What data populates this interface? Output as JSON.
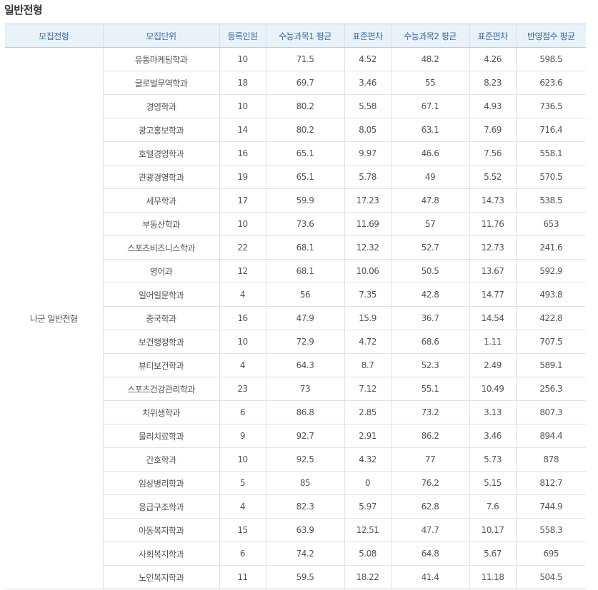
{
  "section_title": "일반전형",
  "headers": [
    "모집전형",
    "모집단위",
    "등록인원",
    "수능과목1 평균",
    "표준편차",
    "수능과목2 평균",
    "표준편차",
    "반영점수 평균"
  ],
  "admission_type": "나군 일반전형",
  "rows": [
    [
      "유통마케팅학과",
      "10",
      "71.5",
      "4.52",
      "48.2",
      "4.26",
      "598.5"
    ],
    [
      "글로벌무역학과",
      "18",
      "69.7",
      "3.46",
      "55",
      "8.23",
      "623.6"
    ],
    [
      "경영학과",
      "10",
      "80.2",
      "5.58",
      "67.1",
      "4.93",
      "736.5"
    ],
    [
      "광고홍보학과",
      "14",
      "80.2",
      "8.05",
      "63.1",
      "7.69",
      "716.4"
    ],
    [
      "호텔경영학과",
      "16",
      "65.1",
      "9.97",
      "46.6",
      "7.56",
      "558.1"
    ],
    [
      "관광경영학과",
      "19",
      "65.1",
      "5.78",
      "49",
      "5.52",
      "570.5"
    ],
    [
      "세무학과",
      "17",
      "59.9",
      "17.23",
      "47.8",
      "14.73",
      "538.5"
    ],
    [
      "부동산학과",
      "10",
      "73.6",
      "11.69",
      "57",
      "11.76",
      "653"
    ],
    [
      "스포츠비즈니스학과",
      "22",
      "68.1",
      "12.32",
      "52.7",
      "12.73",
      "241.6"
    ],
    [
      "영어과",
      "12",
      "68.1",
      "10.06",
      "50.5",
      "13.67",
      "592.9"
    ],
    [
      "일어일문학과",
      "4",
      "56",
      "7.35",
      "42.8",
      "14.77",
      "493.8"
    ],
    [
      "중국학과",
      "16",
      "47.9",
      "15.9",
      "36.7",
      "14.54",
      "422.8"
    ],
    [
      "보건행정학과",
      "10",
      "72.9",
      "4.72",
      "68.6",
      "1.11",
      "707.5"
    ],
    [
      "뷰티보건학과",
      "4",
      "64.3",
      "8.7",
      "52.3",
      "2.49",
      "589.1"
    ],
    [
      "스포츠건강관리학과",
      "23",
      "73",
      "7.12",
      "55.1",
      "10.49",
      "256.3"
    ],
    [
      "치위생학과",
      "6",
      "86.8",
      "2.85",
      "73.2",
      "3.13",
      "807.3"
    ],
    [
      "물리치료학과",
      "9",
      "92.7",
      "2.91",
      "86.2",
      "3.46",
      "894.4"
    ],
    [
      "간호학과",
      "10",
      "92.5",
      "4.32",
      "77",
      "5.73",
      "878"
    ],
    [
      "임상병리학과",
      "5",
      "85",
      "0",
      "76.2",
      "5.15",
      "812.7"
    ],
    [
      "응급구조학과",
      "4",
      "82.3",
      "5.97",
      "62.8",
      "7.6",
      "744.9"
    ],
    [
      "아동복지학과",
      "15",
      "63.9",
      "12.51",
      "47.7",
      "10.17",
      "558.3"
    ],
    [
      "사회복지학과",
      "6",
      "74.2",
      "5.08",
      "64.8",
      "5.67",
      "695"
    ],
    [
      "노인복지학과",
      "11",
      "59.5",
      "18.22",
      "41.4",
      "11.18",
      "504.5"
    ]
  ],
  "colors": {
    "header_bg": "#e9f1f9",
    "header_text": "#3a6ea5",
    "body_text": "#555555",
    "border": "#e2e2e2"
  }
}
